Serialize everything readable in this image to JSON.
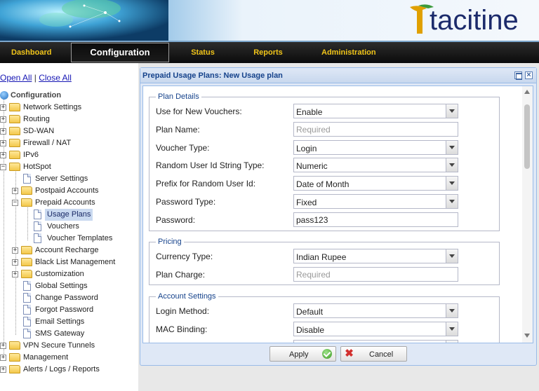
{
  "brand": {
    "logo_text": "tacitine"
  },
  "nav": {
    "tabs": [
      {
        "label": "Dashboard"
      },
      {
        "label": "Configuration"
      },
      {
        "label": "Status"
      },
      {
        "label": "Reports"
      },
      {
        "label": "Administration"
      }
    ],
    "active": "Configuration"
  },
  "sidebar": {
    "open_all": "Open All",
    "separator": "|",
    "close_all": "Close All",
    "root": "Configuration",
    "items": [
      {
        "label": "Network Settings"
      },
      {
        "label": "Routing"
      },
      {
        "label": "SD-WAN"
      },
      {
        "label": "Firewall / NAT"
      },
      {
        "label": "IPv6"
      },
      {
        "label": "HotSpot"
      },
      {
        "label": "Server Settings"
      },
      {
        "label": "Postpaid Accounts"
      },
      {
        "label": "Prepaid Accounts"
      },
      {
        "label": "Usage Plans"
      },
      {
        "label": "Vouchers"
      },
      {
        "label": "Voucher Templates"
      },
      {
        "label": "Account Recharge"
      },
      {
        "label": "Black List Management"
      },
      {
        "label": "Customization"
      },
      {
        "label": "Global Settings"
      },
      {
        "label": "Change Password"
      },
      {
        "label": "Forgot Password"
      },
      {
        "label": "Email Settings"
      },
      {
        "label": "SMS Gateway"
      },
      {
        "label": "VPN Secure Tunnels"
      },
      {
        "label": "Management"
      },
      {
        "label": "Alerts / Logs / Reports"
      }
    ]
  },
  "dialog": {
    "title": "Prepaid Usage Plans: New Usage plan",
    "plan_details": {
      "legend": "Plan Details",
      "use_for_new_vouchers": {
        "label": "Use for New Vouchers:",
        "value": "Enable"
      },
      "plan_name": {
        "label": "Plan Name:",
        "placeholder": "Required"
      },
      "voucher_type": {
        "label": "Voucher Type:",
        "value": "Login"
      },
      "random_user_id_type": {
        "label": "Random User Id String Type:",
        "value": "Numeric"
      },
      "prefix_random_user_id": {
        "label": "Prefix for Random User Id:",
        "value": "Date of Month"
      },
      "password_type": {
        "label": "Password Type:",
        "value": "Fixed"
      },
      "password": {
        "label": "Password:",
        "value": "pass123"
      }
    },
    "pricing": {
      "legend": "Pricing",
      "currency_type": {
        "label": "Currency Type:",
        "value": "Indian Rupee"
      },
      "plan_charge": {
        "label": "Plan Charge:",
        "placeholder": "Required"
      }
    },
    "account_settings": {
      "legend": "Account Settings",
      "login_method": {
        "label": "Login Method:",
        "value": "Default"
      },
      "mac_binding": {
        "label": "MAC Binding:",
        "value": "Disable"
      }
    },
    "apply_label": "Apply",
    "cancel_label": "Cancel"
  },
  "colors": {
    "nav_tab_text": "#f0c419",
    "dialog_title": "#15428b",
    "link": "#1616b4"
  }
}
